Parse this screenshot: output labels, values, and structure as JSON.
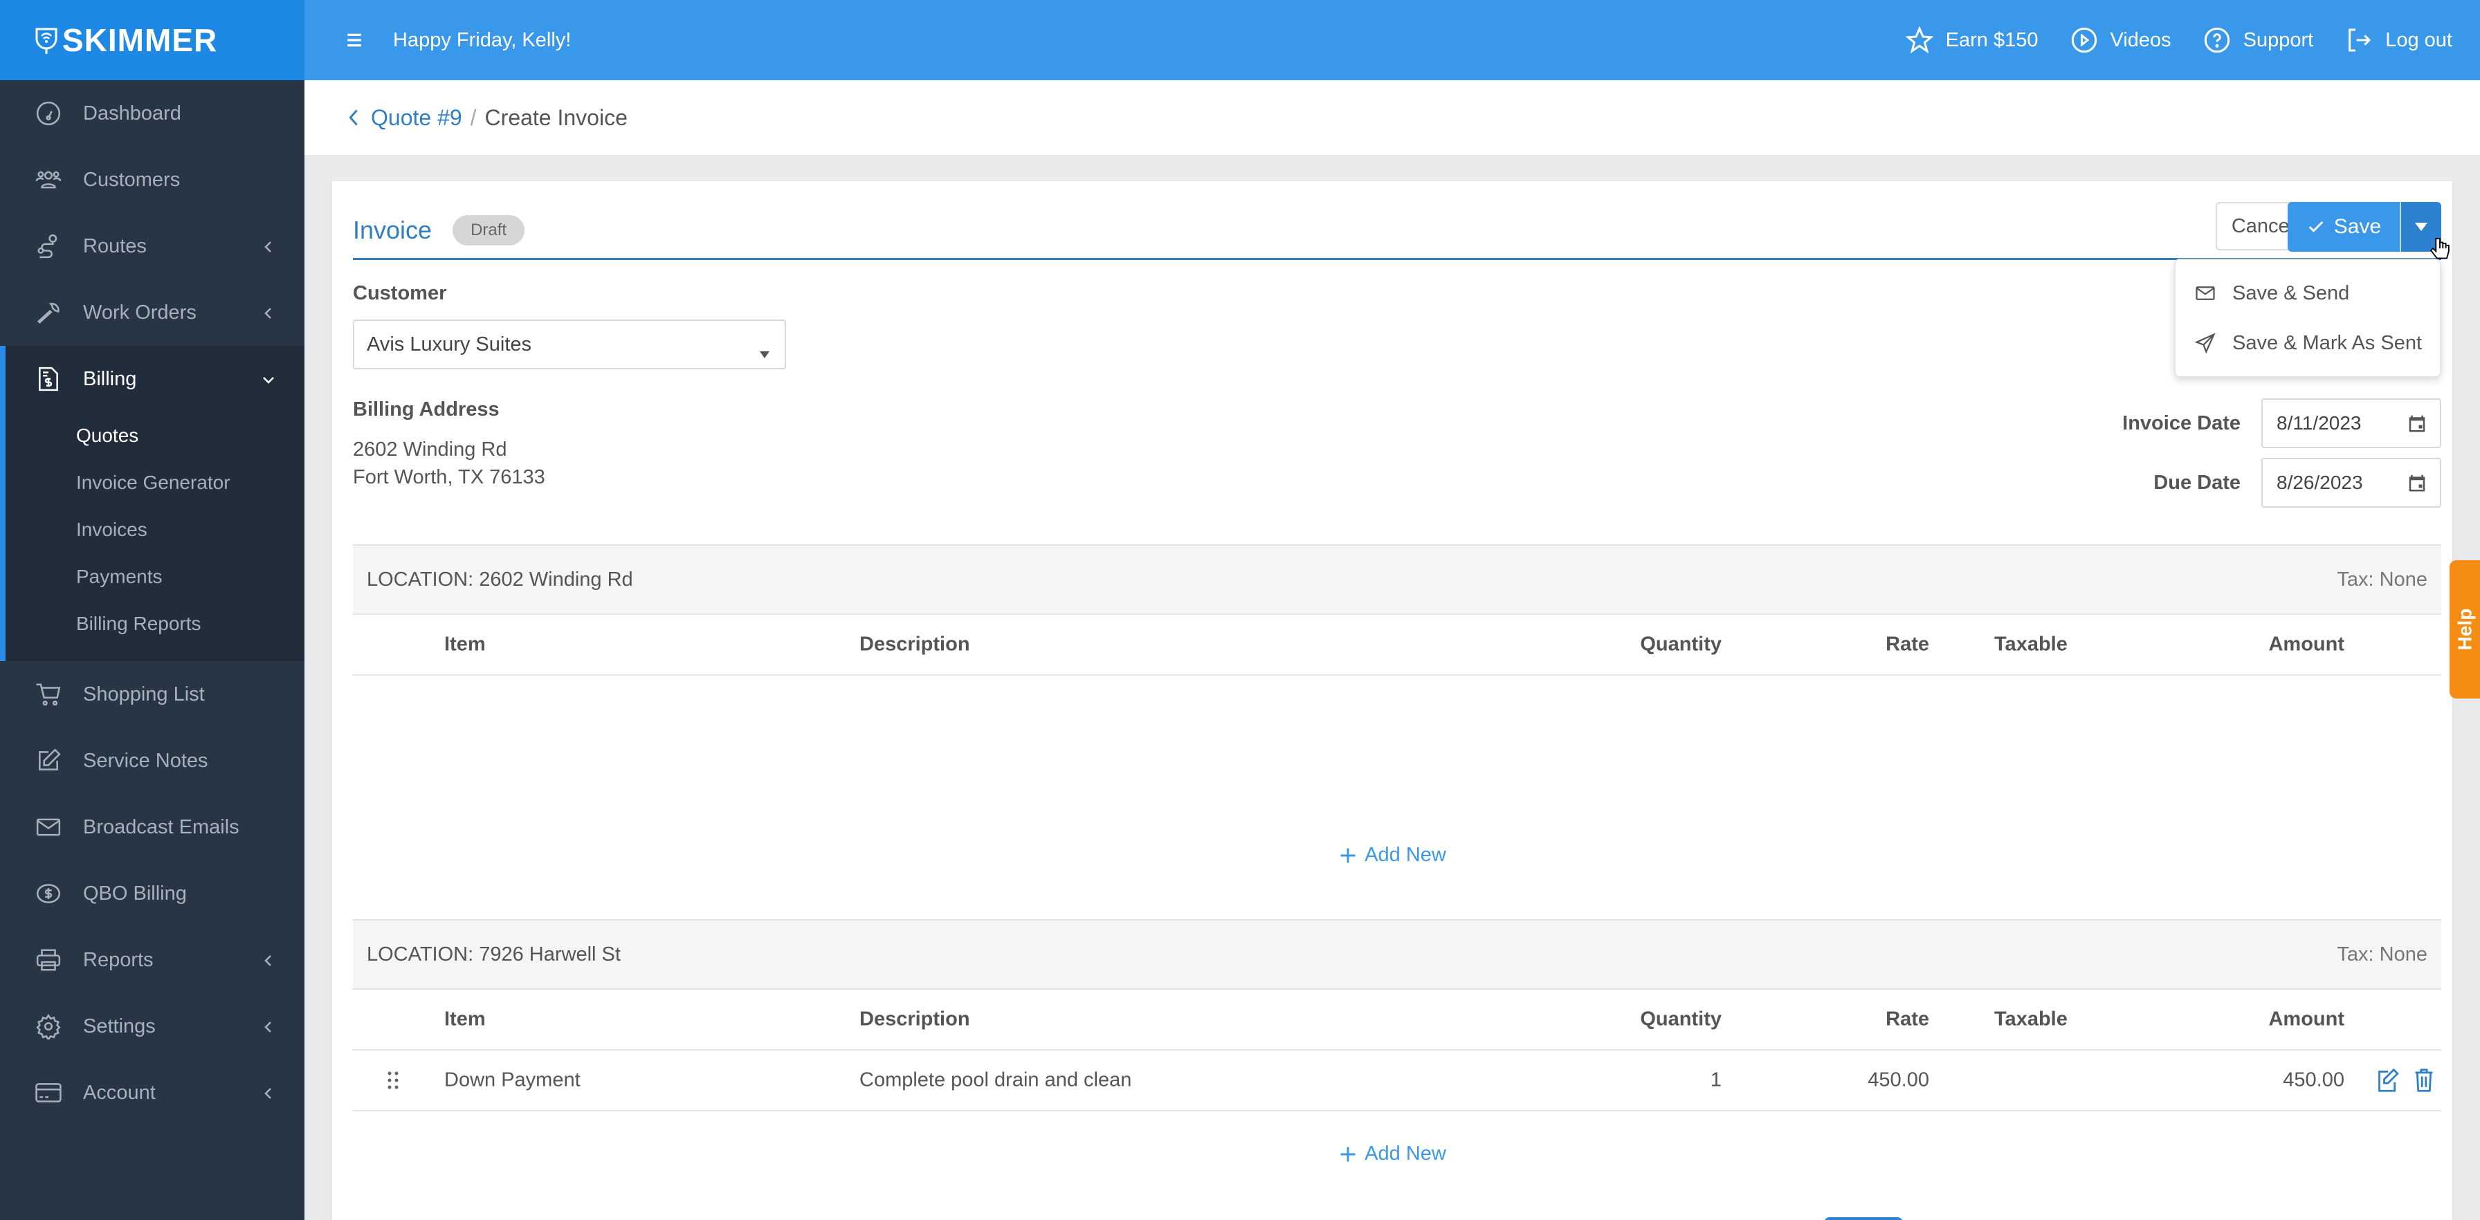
{
  "app": {
    "brand": "SKIMMER"
  },
  "topbar": {
    "greeting": "Happy Friday, Kelly!",
    "links": [
      {
        "label": "Earn $150",
        "icon": "star-icon"
      },
      {
        "label": "Videos",
        "icon": "play-circle-icon"
      },
      {
        "label": "Support",
        "icon": "question-circle-icon"
      },
      {
        "label": "Log out",
        "icon": "logout-icon"
      }
    ]
  },
  "sidebar": {
    "items": [
      {
        "label": "Dashboard",
        "icon": "dashboard-icon",
        "expandable": false
      },
      {
        "label": "Customers",
        "icon": "customers-icon",
        "expandable": false
      },
      {
        "label": "Routes",
        "icon": "routes-icon",
        "expandable": true
      },
      {
        "label": "Work Orders",
        "icon": "wrench-icon",
        "expandable": true
      },
      {
        "label": "Billing",
        "icon": "billing-icon",
        "expandable": true,
        "expanded": true
      },
      {
        "label": "Shopping List",
        "icon": "cart-icon",
        "expandable": false
      },
      {
        "label": "Service Notes",
        "icon": "edit-icon",
        "expandable": false
      },
      {
        "label": "Broadcast Emails",
        "icon": "envelope-icon",
        "expandable": false
      },
      {
        "label": "QBO Billing",
        "icon": "dollar-circle-icon",
        "expandable": false
      },
      {
        "label": "Reports",
        "icon": "printer-icon",
        "expandable": true
      },
      {
        "label": "Settings",
        "icon": "gear-icon",
        "expandable": true
      },
      {
        "label": "Account",
        "icon": "credit-card-icon",
        "expandable": true
      }
    ],
    "billing_sub": [
      {
        "label": "Quotes",
        "active": true
      },
      {
        "label": "Invoice Generator"
      },
      {
        "label": "Invoices"
      },
      {
        "label": "Payments"
      },
      {
        "label": "Billing Reports"
      }
    ]
  },
  "breadcrumb": {
    "parent": "Quote #9",
    "separator": "/",
    "current": "Create Invoice"
  },
  "invoice": {
    "title": "Invoice",
    "status": "Draft",
    "cancel_label": "Cancel",
    "save_label": "Save",
    "save_menu": [
      {
        "label": "Save & Send",
        "icon": "envelope-icon"
      },
      {
        "label": "Save & Mark As Sent",
        "icon": "paper-plane-icon"
      }
    ],
    "customer_label": "Customer",
    "customer_value": "Avis Luxury Suites",
    "billing_address_label": "Billing Address",
    "billing_address_lines": [
      "2602 Winding Rd",
      "Fort Worth, TX 76133"
    ],
    "invoice_date_label": "Invoice Date",
    "invoice_date": "8/11/2023",
    "due_date_label": "Due Date",
    "due_date": "8/26/2023"
  },
  "table_columns": [
    "Item",
    "Description",
    "Quantity",
    "Rate",
    "Taxable",
    "Amount"
  ],
  "locations": [
    {
      "label": "LOCATION: 2602 Winding Rd",
      "tax": "Tax: None",
      "rows": [],
      "add_label": "Add New"
    },
    {
      "label": "LOCATION: 7926 Harwell St",
      "tax": "Tax: None",
      "rows": [
        {
          "item": "Down Payment",
          "description": "Complete pool drain and clean",
          "quantity": "1",
          "rate": "450.00",
          "taxable": "",
          "amount": "450.00"
        }
      ],
      "add_label": "Add New"
    }
  ],
  "help_label": "Help",
  "colors": {
    "brand_blue": "#1e88e5",
    "topbar": "#3a98ea",
    "sidebar": "#283545",
    "link": "#2e7fc5",
    "help": "#f58d14"
  }
}
